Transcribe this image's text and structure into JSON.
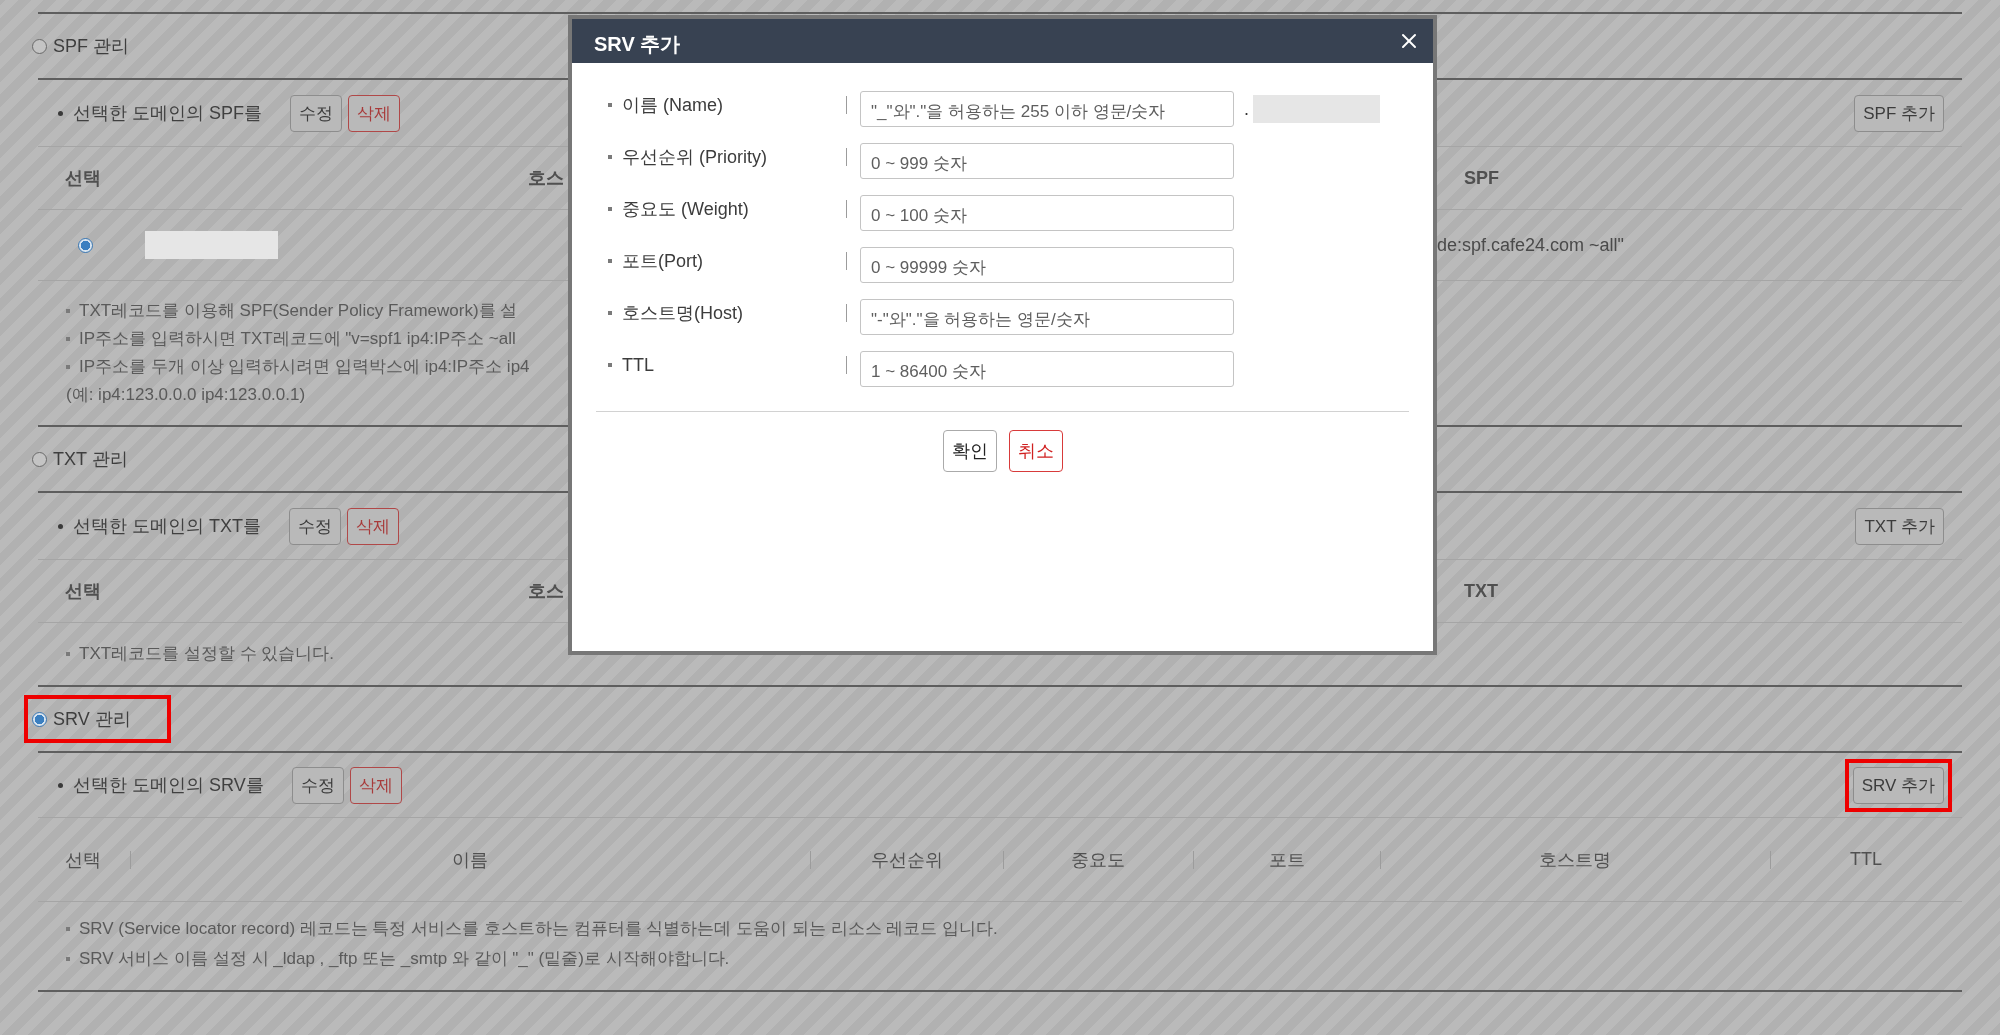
{
  "sections": [
    {
      "kind": "covered",
      "title": "SPF 관리",
      "selected": false,
      "highlighted": false,
      "toolbar": {
        "caption": "선택한 도메인의 SPF를",
        "edit": "수정",
        "delete": "삭제",
        "add": "SPF 추가",
        "add_highlighted": false
      },
      "columns": [
        "선택",
        "호스",
        "SPF"
      ],
      "rows": [
        {
          "selected": true,
          "column_3": "de:spf.cafe24.com ~all\""
        }
      ],
      "notes": [
        {
          "kind": "bullet",
          "text": "TXT레코드를 이용해 SPF(Sender Policy Framework)를 설"
        },
        {
          "kind": "bullet",
          "text": "IP주소를 입력하시면 TXT레코드에 \"v=spf1 ip4:IP주소 ~all"
        },
        {
          "kind": "bullet",
          "text": "IP주소를 두개 이상 입력하시려면 입력박스에 ip4:IP주소 ip4"
        },
        {
          "kind": "continuation",
          "text": "(예: ip4:123.0.0.0 ip4:123.0.0.1)"
        }
      ]
    },
    {
      "kind": "covered",
      "title": "TXT 관리",
      "selected": false,
      "highlighted": false,
      "toolbar": {
        "caption": "선택한 도메인의 TXT를",
        "edit": "수정",
        "delete": "삭제",
        "add": "TXT 추가",
        "add_highlighted": false
      },
      "columns": [
        "선택",
        "호스",
        "TXT"
      ],
      "notes": [
        {
          "kind": "bullet",
          "text": "TXT레코드를 설정할 수 있습니다."
        }
      ]
    },
    {
      "kind": "full",
      "title": "SRV 관리",
      "selected": true,
      "highlighted": true,
      "toolbar": {
        "caption": "선택한 도메인의 SRV를",
        "edit": "수정",
        "delete": "삭제",
        "add": "SRV 추가",
        "add_highlighted": true
      },
      "columns": [
        "선택",
        "이름",
        "우선순위",
        "중요도",
        "포트",
        "호스트명",
        "TTL"
      ],
      "notes": [
        {
          "kind": "bullet",
          "text": "SRV (Service locator record) 레코드는 특정 서비스를 호스트하는 컴퓨터를 식별하는데 도움이 되는 리소스 레코드 입니다."
        },
        {
          "kind": "bullet",
          "text": "SRV 서비스 이름 설정 시 _ldap , _ftp 또는 _smtp 와 같이 \"_\" (밑줄)로 시작해야합니다."
        }
      ]
    }
  ],
  "dialog": {
    "title": "SRV 추가",
    "fields": [
      {
        "label": "이름 (Name)",
        "placeholder": "\"_\"와\".\"을 허용하는 255 이하 영문/숫자",
        "suffix": "."
      },
      {
        "label": "우선순위 (Priority)",
        "placeholder": "0 ~ 999 숫자"
      },
      {
        "label": "중요도 (Weight)",
        "placeholder": "0 ~ 100 숫자"
      },
      {
        "label": "포트(Port)",
        "placeholder": "0 ~ 99999 숫자"
      },
      {
        "label": "호스트명(Host)",
        "placeholder": "\"-\"와\".\"을 허용하는 영문/숫자"
      },
      {
        "label": "TTL",
        "placeholder": "1 ~ 86400 숫자"
      }
    ],
    "buttons": [
      {
        "kind": "confirm",
        "label": "확인"
      },
      {
        "kind": "cancel",
        "label": "취소"
      }
    ]
  }
}
